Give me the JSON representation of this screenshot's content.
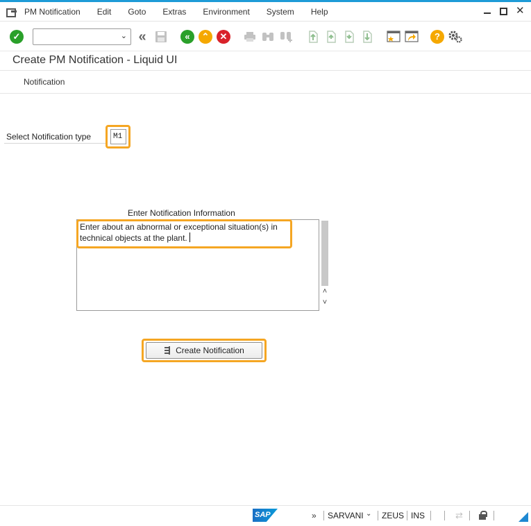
{
  "menubar": {
    "items": [
      "PM Notification",
      "Edit",
      "Goto",
      "Extras",
      "Environment",
      "System",
      "Help"
    ]
  },
  "toolbar": {
    "command_field_value": ""
  },
  "screen": {
    "title": "Create PM Notification - Liquid UI",
    "subtoolbar_item": "Notification"
  },
  "form": {
    "notification_type_label": "Select Notification type",
    "notification_type_value": "M1",
    "info_label": "Enter Notification Information",
    "info_text": "Enter about an abnormal or exceptional situation(s) in technical objects at the plant.",
    "create_button_label": "Create Notification"
  },
  "statusbar": {
    "logo_text": "SAP",
    "chevron": "»",
    "user": "SARVANI",
    "system": "ZEUS",
    "mode": "INS"
  },
  "colors": {
    "accent": "#1e9bd7",
    "highlight": "#f5a623",
    "enter_green": "#2aa02a",
    "up_yellow": "#f5a800",
    "cancel_red": "#d9222a"
  }
}
